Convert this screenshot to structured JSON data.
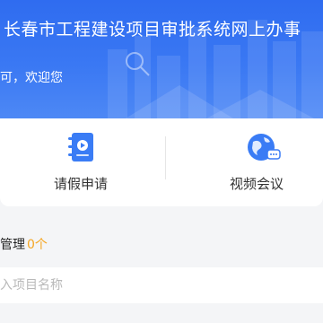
{
  "header": {
    "title": "长春市工程建设项目审批系统网上办事",
    "welcome": "可，欢迎您"
  },
  "quick_actions": [
    {
      "label": "请假申请",
      "icon": "notebook-icon",
      "color": "#3a7cf5"
    },
    {
      "label": "视频会议",
      "icon": "globe-chat-icon",
      "color": "#3a7cf5"
    }
  ],
  "project_section": {
    "title": "管理",
    "count": "0个"
  },
  "search": {
    "placeholder": "入项目名称"
  },
  "colors": {
    "header": "#3a78f3",
    "accent": "#3a7cf5",
    "count": "#f5a623"
  }
}
